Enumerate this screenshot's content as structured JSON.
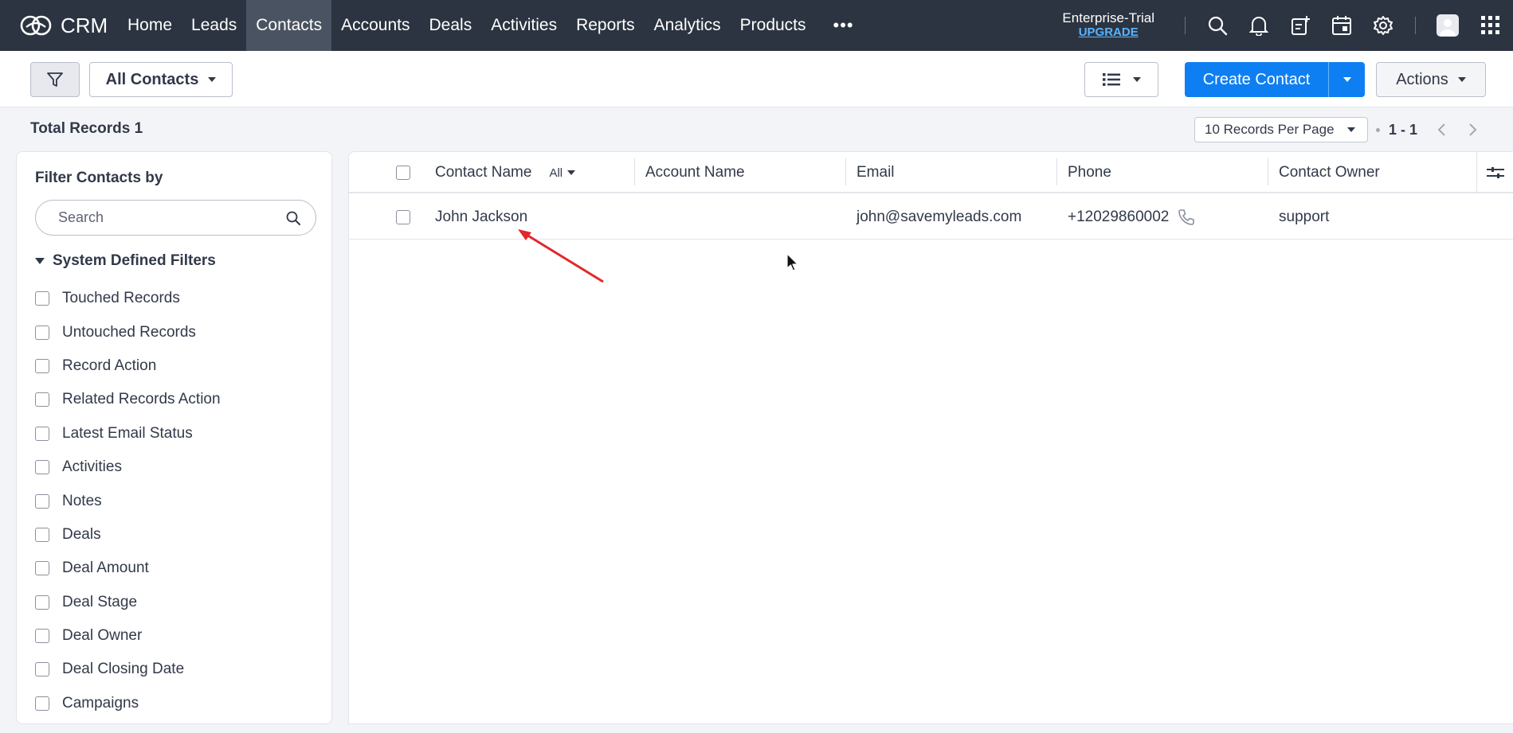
{
  "app": {
    "name": "CRM",
    "nav": [
      "Home",
      "Leads",
      "Contacts",
      "Accounts",
      "Deals",
      "Activities",
      "Reports",
      "Analytics",
      "Products"
    ],
    "active_nav": "Contacts",
    "more": "•••",
    "edition": "Enterprise-Trial",
    "upgrade": "UPGRADE"
  },
  "toolbar": {
    "view": "All Contacts",
    "create_label": "Create Contact",
    "actions_label": "Actions"
  },
  "records": {
    "total_label": "Total Records",
    "total_count": "1",
    "per_page": "10 Records Per Page",
    "range": "1 - 1"
  },
  "sidebar": {
    "title": "Filter Contacts by",
    "search_placeholder": "Search",
    "section_title": "System Defined Filters",
    "filters": [
      "Touched Records",
      "Untouched Records",
      "Record Action",
      "Related Records Action",
      "Latest Email Status",
      "Activities",
      "Notes",
      "Deals",
      "Deal Amount",
      "Deal Stage",
      "Deal Owner",
      "Deal Closing Date",
      "Campaigns"
    ]
  },
  "table": {
    "columns": {
      "contact_name": "Contact Name",
      "contact_name_filter": "All",
      "account_name": "Account Name",
      "email": "Email",
      "phone": "Phone",
      "owner": "Contact Owner"
    },
    "rows": [
      {
        "contact_name": "John Jackson",
        "account_name": "",
        "email": "john@savemyleads.com",
        "phone": "+12029860002",
        "owner": "support"
      }
    ]
  },
  "colors": {
    "nav_bg": "#2c3441",
    "primary": "#0e7ff2",
    "annotation_arrow": "#e3262b"
  }
}
